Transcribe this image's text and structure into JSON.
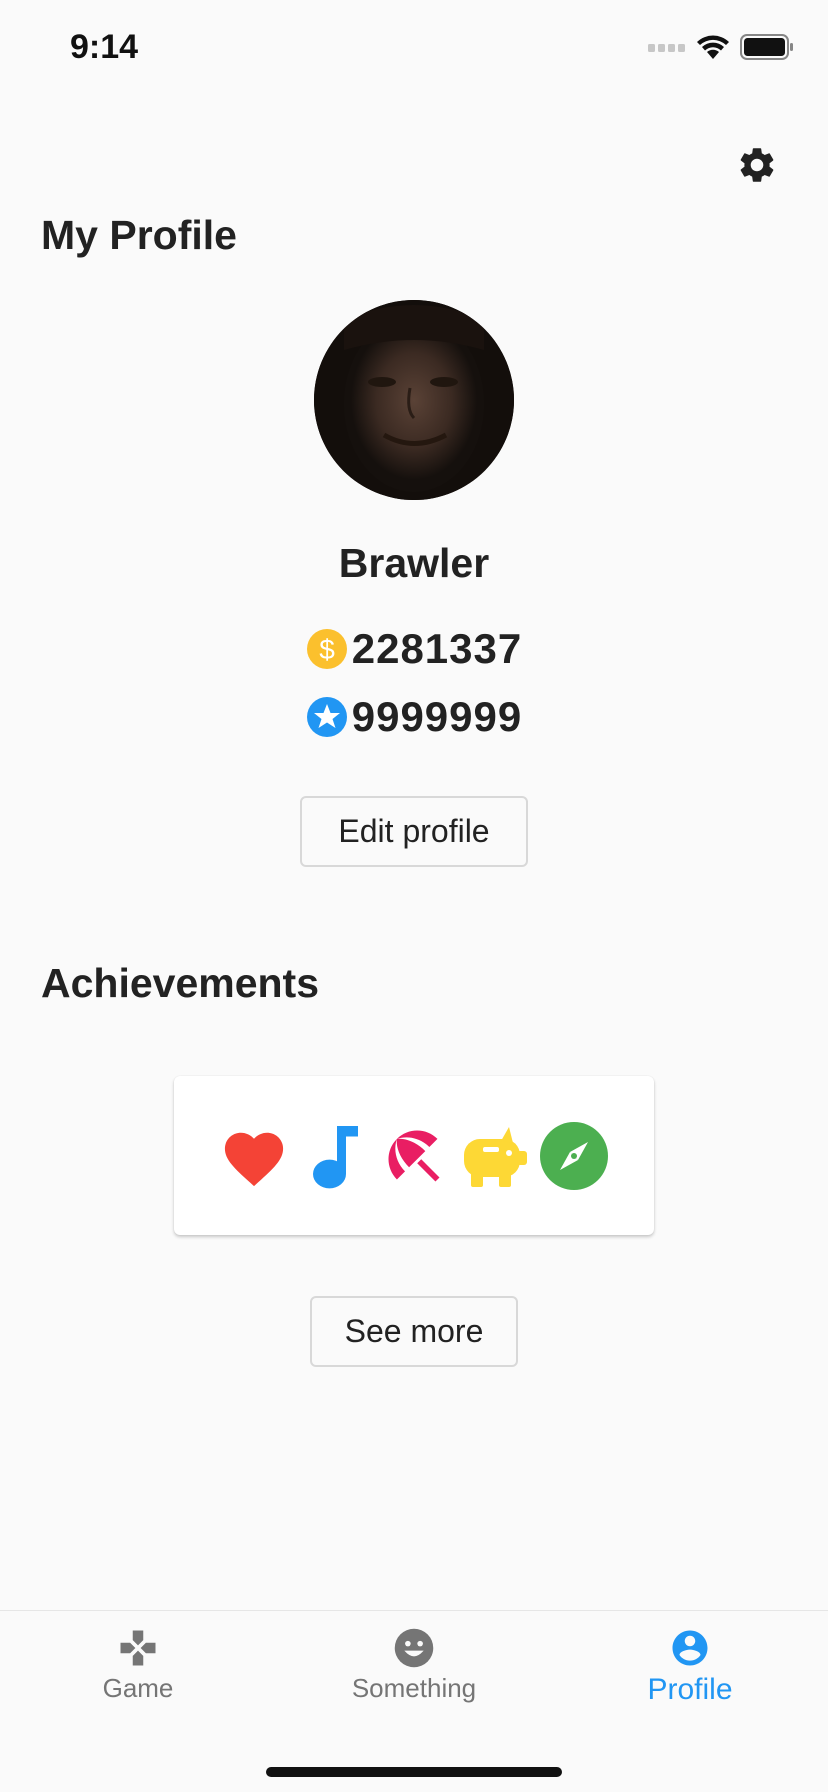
{
  "status_bar": {
    "time": "9:14"
  },
  "profile": {
    "title": "My Profile",
    "username": "Brawler",
    "coins": "2281337",
    "stars": "9999999",
    "edit_label": "Edit profile"
  },
  "achievements": {
    "title": "Achievements",
    "icons": [
      "heart-icon",
      "music-note-icon",
      "beach-umbrella-icon",
      "piggy-bank-icon",
      "compass-icon"
    ],
    "see_more_label": "See more"
  },
  "tabs": [
    {
      "label": "Game",
      "icon": "gamepad-icon",
      "active": false
    },
    {
      "label": "Something",
      "icon": "smiley-icon",
      "active": false
    },
    {
      "label": "Profile",
      "icon": "account-icon",
      "active": true
    }
  ],
  "colors": {
    "accent": "#2196f3",
    "coin": "#fbc02d",
    "star_badge": "#2196f3",
    "heart": "#f44336",
    "umbrella": "#e91e63",
    "piggy": "#fdd835",
    "compass": "#4caf50",
    "inactive_tab": "#757575"
  }
}
